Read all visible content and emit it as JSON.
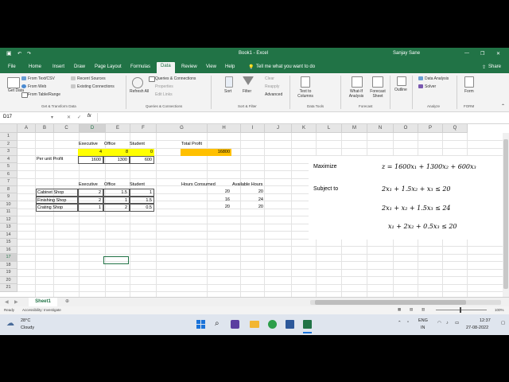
{
  "titlebar": {
    "autosave_icon": "save-icon",
    "title": "Book1 - Excel",
    "user": "Sanjay Sane"
  },
  "menu": [
    "File",
    "Home",
    "Insert",
    "Draw",
    "Page Layout",
    "Formulas",
    "Data",
    "Review",
    "View",
    "Help"
  ],
  "tell_me": "Tell me what you want to do",
  "share": "Share",
  "ribbon": {
    "get_data": "Get Data",
    "from_text": "From Text/CSV",
    "from_web": "From Web",
    "from_table": "From Table/Range",
    "recent_sources": "Recent Sources",
    "existing_connections": "Existing Connections",
    "group_get": "Get & Transform Data",
    "refresh": "Refresh All",
    "queries": "Queries & Connections",
    "properties": "Properties",
    "edit_links": "Edit Links",
    "group_queries": "Queries & Connections",
    "sort": "Sort",
    "filter": "Filter",
    "clear": "Clear",
    "reapply": "Reapply",
    "advanced": "Advanced",
    "group_sort": "Sort & Filter",
    "text_to_columns": "Text to Columns",
    "group_tools": "Data Tools",
    "whatif": "What-If Analysis",
    "forecast_sheet": "Forecast Sheet",
    "group_forecast": "Forecast",
    "outline": "Outline",
    "data_analysis": "Data Analysis",
    "solver": "Solver",
    "group_analyze": "Analyze",
    "form": "Form",
    "group_form": "FORM"
  },
  "formula_bar": {
    "name_box": "D17",
    "fx": "fx",
    "value": ""
  },
  "columns": [
    "A",
    "B",
    "C",
    "D",
    "E",
    "F",
    "G",
    "H",
    "I",
    "J",
    "K",
    "L",
    "M",
    "N",
    "O",
    "P",
    "Q"
  ],
  "rows": [
    "1",
    "2",
    "3",
    "4",
    "5",
    "6",
    "7",
    "8",
    "9",
    "10",
    "11",
    "12",
    "13",
    "14",
    "15",
    "16",
    "17",
    "18",
    "19",
    "20",
    "21"
  ],
  "cells": {
    "c2": "Executive",
    "d2": "Office",
    "e2": "Student",
    "g2": "Total Profit",
    "c3": "4",
    "d3": "8",
    "e3": "0",
    "g3": "16800",
    "b4": "Per unit Profit",
    "c4": "1600",
    "d4": "1300",
    "e4": "600",
    "c7": "Executive",
    "d7": "Office",
    "e7": "Student",
    "g7": "Hours Consumed",
    "h7": "Available Hours",
    "b8": "Cabinet Shop",
    "c8": "2",
    "d8": "1.5",
    "e8": "1",
    "g8": "20",
    "h8": "20",
    "b9": "Finishing Shop",
    "c9": "2",
    "d9": "1",
    "e9": "1.5",
    "g9": "16",
    "h9": "24",
    "b10": "Crating Shop",
    "c10": "1",
    "d10": "2",
    "e10": "0.5",
    "g10": "20",
    "h10": "20"
  },
  "lp": {
    "maximize": "Maximize",
    "objective": "z = 1600x₁ + 1300x₂ + 600x₃",
    "subject_to": "Subject to",
    "c1": "2x₁ + 1.5x₂ + x₃ ≤ 20",
    "c2": "2x₁ +   x₂ + 1.5x₃ ≤ 24",
    "c3": "x₁ + 2x₂ + 0.5x₃ ≤ 20"
  },
  "sheet_tab": "Sheet1",
  "status": {
    "ready": "Ready",
    "accessibility": "Accessibility: Investigate",
    "zoom": "100%"
  },
  "taskbar": {
    "temp": "28°C",
    "weather": "Cloudy",
    "lang1": "ENG",
    "lang2": "IN",
    "time": "12:37",
    "date": "27-08-2022"
  },
  "colors": {
    "excel_green": "#217346",
    "highlight_yellow": "#ffff00",
    "highlight_orange": "#ffc000"
  }
}
